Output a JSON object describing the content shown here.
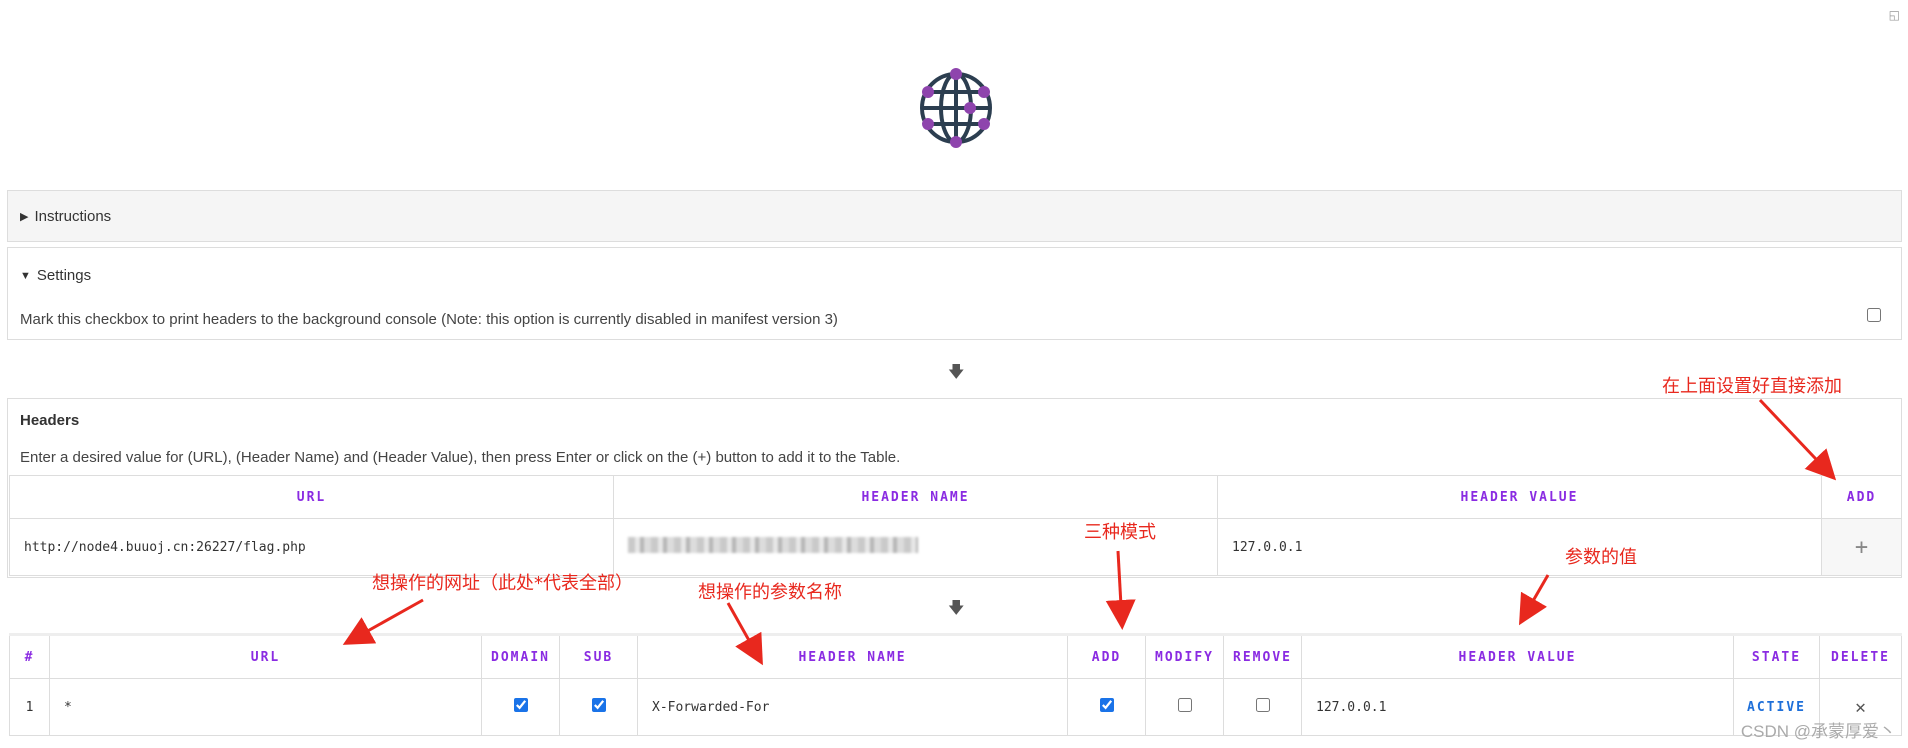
{
  "logo": {
    "icon": "globe-network-icon",
    "color": "#8e44ad"
  },
  "instructions": {
    "label": "Instructions",
    "expanded": false
  },
  "settings": {
    "label": "Settings",
    "expanded": true,
    "console_note": "Mark this checkbox to print headers to the background console (Note: this option is currently disabled in manifest version 3)",
    "console_checked": false
  },
  "headers": {
    "title": "Headers",
    "description": "Enter a desired value for (URL), (Header Name) and (Header Value), then press Enter or click on the (+) button to add it to the Table.",
    "input_table": {
      "columns": [
        "URL",
        "HEADER NAME",
        "HEADER VALUE",
        "ADD"
      ],
      "row": {
        "url": "http://node4.buuoj.cn:26227/flag.php",
        "header_value": "127.0.0.1",
        "add_icon": "+"
      }
    },
    "rules_table": {
      "columns": [
        "#",
        "URL",
        "DOMAIN",
        "SUB",
        "HEADER NAME",
        "ADD",
        "MODIFY",
        "REMOVE",
        "HEADER VALUE",
        "STATE",
        "DELETE"
      ],
      "rows": [
        {
          "index": "1",
          "url": "*",
          "domain": true,
          "sub": true,
          "header_name": "X-Forwarded-For",
          "add": true,
          "modify": false,
          "remove": false,
          "header_value": "127.0.0.1",
          "state": "ACTIVE",
          "delete_icon": "✕"
        }
      ]
    }
  },
  "annotations": {
    "add_hint": "在上面设置好直接添加",
    "modes": "三种模式",
    "value": "参数的值",
    "url": "想操作的网址（此处*代表全部）",
    "name": "想操作的参数名称"
  },
  "watermark": "CSDN @承蒙厚爱丶",
  "colors": {
    "header_text": "#8a2be2",
    "annotation": "#e8281e",
    "active": "#1e6fd9"
  }
}
